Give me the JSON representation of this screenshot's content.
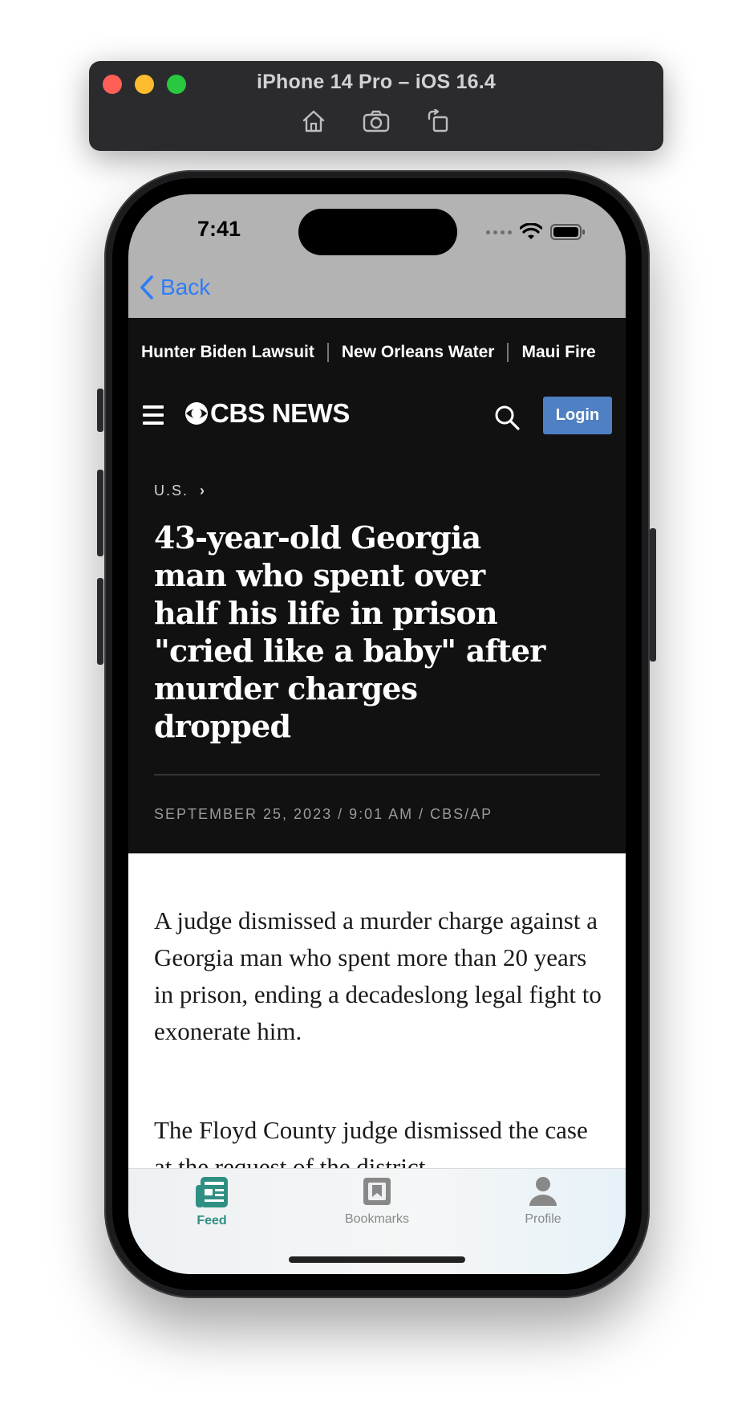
{
  "simulator": {
    "title": "iPhone 14 Pro – iOS 16.4",
    "tools": [
      "home-icon",
      "screenshot-icon",
      "rotate-icon"
    ]
  },
  "status_bar": {
    "time": "7:41"
  },
  "nav": {
    "back_label": "Back"
  },
  "trending": [
    "Hunter Biden Lawsuit",
    "New Orleans Water",
    "Maui Fire"
  ],
  "header": {
    "logo_text": "CBS NEWS",
    "login_label": "Login"
  },
  "article": {
    "section": "U.S.",
    "section_chevron": "›",
    "headline": "43-year-old Georgia man who spent over half his life in prison \"cried like a baby\" after murder charges dropped",
    "meta": "SEPTEMBER 25, 2023 / 9:01 AM / CBS/AP",
    "paragraphs": [
      "A judge dismissed a murder charge against a Georgia man who spent more than 20 years in prison, ending a decadeslong legal fight to exonerate him.",
      "The Floyd County judge dismissed the case at the request of the district"
    ]
  },
  "tabbar": {
    "items": [
      {
        "label": "Feed",
        "icon": "feed-icon",
        "active": true
      },
      {
        "label": "Bookmarks",
        "icon": "bookmark-icon",
        "active": false
      },
      {
        "label": "Profile",
        "icon": "person-icon",
        "active": false
      }
    ]
  },
  "colors": {
    "accent_blue": "#2f7cf6",
    "login_bg": "#4e80c3",
    "tab_active": "#2f8f82",
    "header_bg": "#111111"
  }
}
